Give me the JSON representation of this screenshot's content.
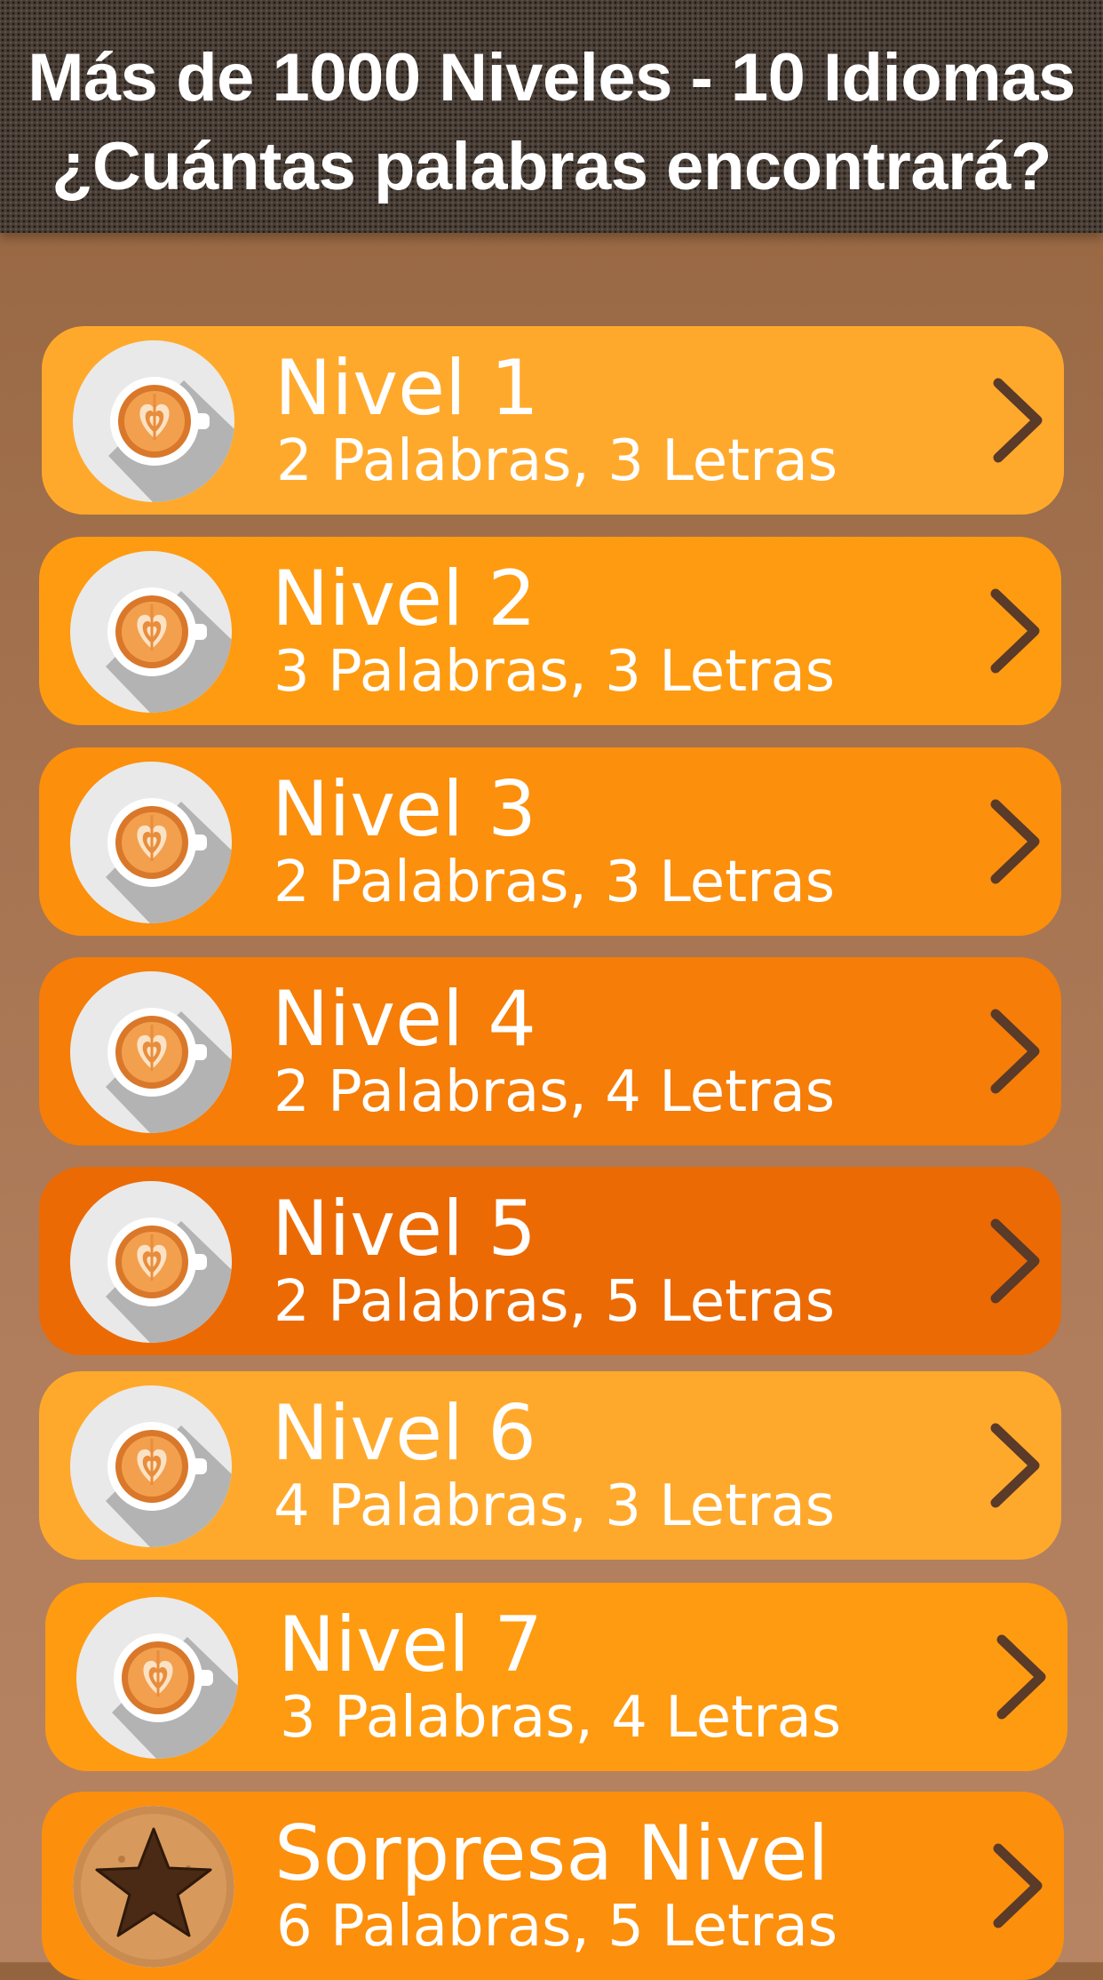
{
  "header": {
    "line1": "Más de 1000 Niveles - 10 Idiomas",
    "line2": "¿Cuántas palabras encontrará?"
  },
  "levels": [
    {
      "title": "Nivel 1",
      "subtitle": "2 Palabras, 3 Letras",
      "icon": "latte-cup-icon",
      "color": "#ffa92c"
    },
    {
      "title": "Nivel 2",
      "subtitle": "3 Palabras, 3 Letras",
      "icon": "latte-cup-icon",
      "color": "#ff9b10"
    },
    {
      "title": "Nivel 3",
      "subtitle": "2 Palabras, 3 Letras",
      "icon": "latte-cup-icon",
      "color": "#fc8f0c"
    },
    {
      "title": "Nivel 4",
      "subtitle": "2 Palabras, 4 Letras",
      "icon": "latte-cup-icon",
      "color": "#f57d08"
    },
    {
      "title": "Nivel 5",
      "subtitle": "2 Palabras, 5 Letras",
      "icon": "latte-cup-icon",
      "color": "#ec6a04"
    },
    {
      "title": "Nivel 6",
      "subtitle": "4 Palabras, 3 Letras",
      "icon": "latte-cup-icon",
      "color": "#ffa92c"
    },
    {
      "title": "Nivel 7",
      "subtitle": "3 Palabras, 4 Letras",
      "icon": "latte-cup-icon",
      "color": "#ff9b10"
    },
    {
      "title": "Sorpresa Nivel",
      "subtitle": "6 Palabras, 5 Letras",
      "icon": "star-cookie-icon",
      "color": "#fc8f0c"
    }
  ],
  "colors": {
    "chevron": "#5a3a28",
    "text": "#ffffff"
  }
}
